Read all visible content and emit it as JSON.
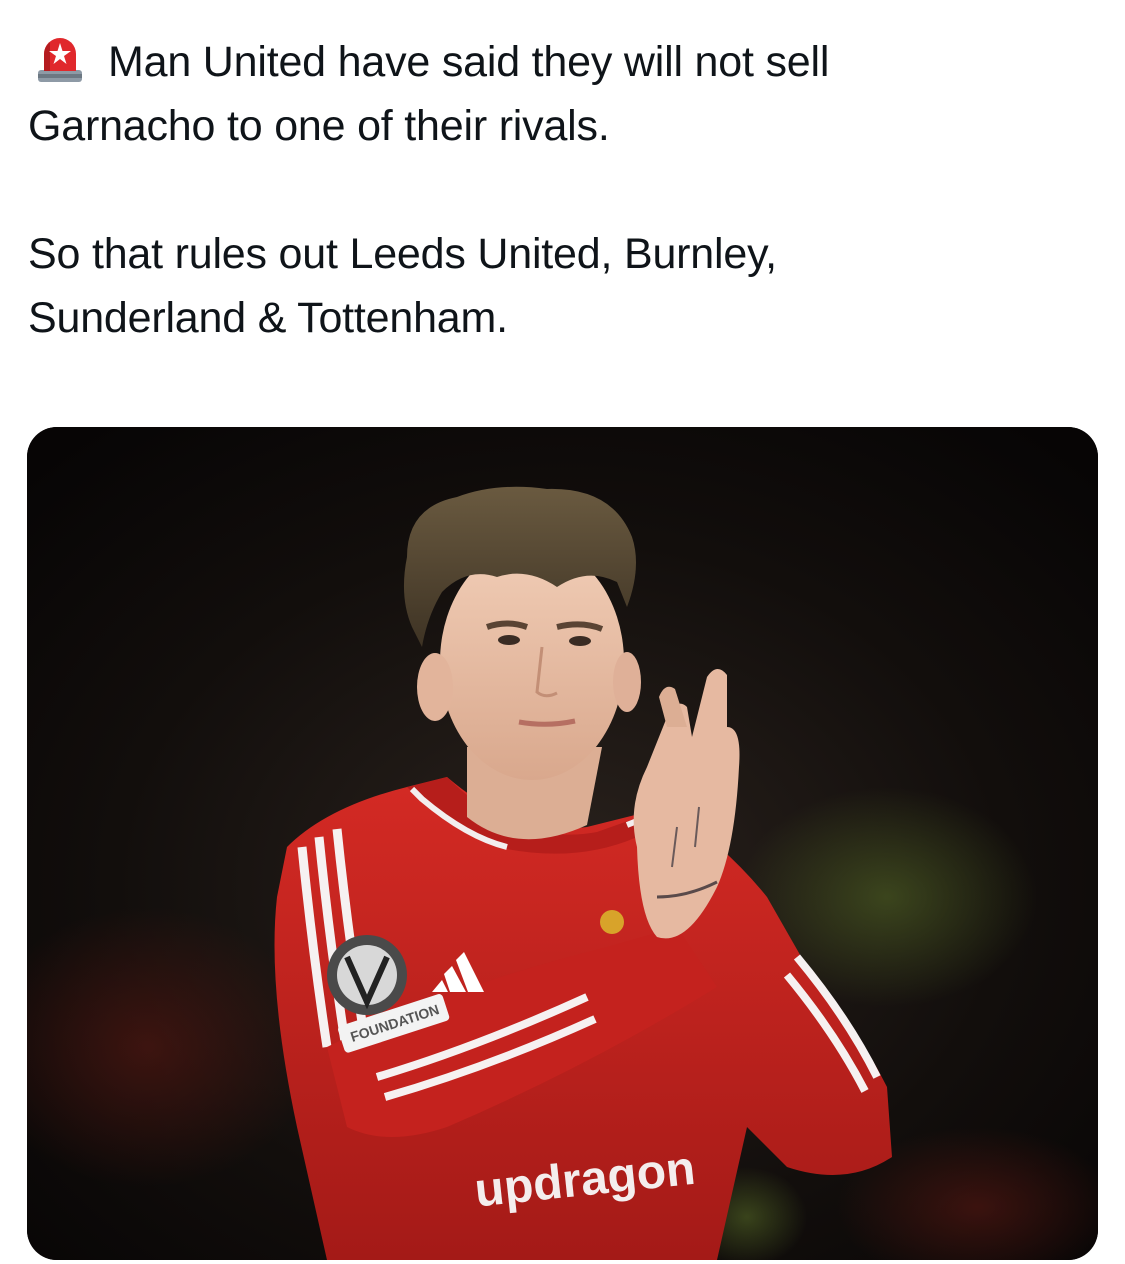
{
  "tweet": {
    "alert_icon": "police-car-light-icon",
    "lines": [
      "Man United have said they will not sell",
      "Garnacho to one of their rivals.",
      "So that rules out Leeds United, Burnley,",
      "Sunderland & Tottenham."
    ]
  },
  "media": {
    "shirt_sponsor": "updragon",
    "sleeve_patch": "FOUNDATION",
    "colors": {
      "shirt": "#c7231f",
      "background": "#0a0706"
    }
  }
}
